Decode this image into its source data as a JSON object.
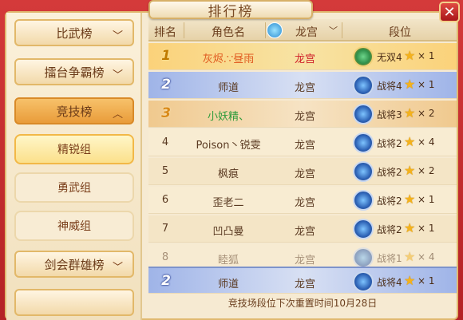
{
  "title": "排行榜",
  "sidebar": {
    "main_items": [
      {
        "label": "比武榜"
      },
      {
        "label": "擂台争霸榜"
      },
      {
        "label": "竞技榜"
      },
      {
        "label": "剑会群雄榜"
      }
    ],
    "sub_items": [
      {
        "label": "精锐组"
      },
      {
        "label": "勇武组"
      },
      {
        "label": "神威组"
      }
    ]
  },
  "table": {
    "headers": {
      "rank": "排名",
      "name": "角色名",
      "sect": "龙宫",
      "tier": "段位"
    },
    "rows": [
      {
        "rank": "1",
        "name": "灰烬.∵昼雨",
        "sect": "龙宫",
        "tier": "无双4",
        "stars": "× 1"
      },
      {
        "rank": "2",
        "name": "师道",
        "sect": "龙宫",
        "tier": "战将4",
        "stars": "× 1"
      },
      {
        "rank": "3",
        "name": "小妖精、",
        "sect": "龙宫",
        "tier": "战将3",
        "stars": "× 2"
      },
      {
        "rank": "4",
        "name": "Poison丶锐雯",
        "sect": "龙宫",
        "tier": "战将2",
        "stars": "× 4"
      },
      {
        "rank": "5",
        "name": "枫痕",
        "sect": "龙宫",
        "tier": "战将2",
        "stars": "× 2"
      },
      {
        "rank": "6",
        "name": "歪老二",
        "sect": "龙宫",
        "tier": "战将2",
        "stars": "× 1"
      },
      {
        "rank": "7",
        "name": "凹凸曼",
        "sect": "龙宫",
        "tier": "战将2",
        "stars": "× 1"
      },
      {
        "rank": "8",
        "name": "睦狐",
        "sect": "龙宫",
        "tier": "战将1",
        "stars": "× 4"
      }
    ],
    "my_row": {
      "rank": "2",
      "name": "师道",
      "sect": "龙宫",
      "tier": "战将4",
      "stars": "× 1"
    }
  },
  "footer": "竞技场段位下次重置时间10月28日"
}
